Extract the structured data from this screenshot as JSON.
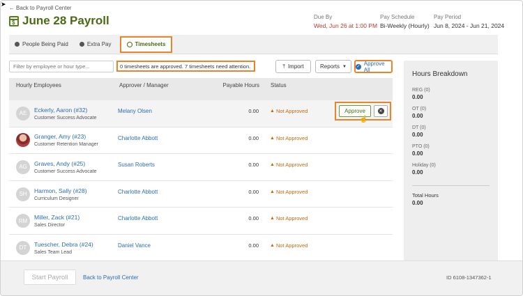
{
  "header": {
    "back_link": "Back to Payroll Center",
    "title": "June 28 Payroll",
    "calendar_glyph": "$",
    "due_by_label": "Due By",
    "due_by_value": "Wed, Jun 26 at 1:00 PM",
    "pay_schedule_label": "Pay Schedule",
    "pay_schedule_value": "Bi-Weekly (Hourly)",
    "pay_period_label": "Pay Period",
    "pay_period_value": "Jun 8, 2024 - Jun 21, 2024"
  },
  "tabs": [
    {
      "label": "People Being Paid",
      "icon": "person-icon"
    },
    {
      "label": "Extra Pay",
      "icon": "dollar-icon"
    },
    {
      "label": "Timesheets",
      "icon": "clock-icon",
      "active": true
    }
  ],
  "toolbar": {
    "filter_placeholder": "Filter by employee or hour type...",
    "status_note": "0 timesheets are approved. 7 timesheets need attention.",
    "import_label": "Import",
    "reports_label": "Reports",
    "approve_all_label": "Approve All"
  },
  "table": {
    "headers": {
      "employee": "Hourly Employees",
      "manager": "Approver / Manager",
      "hours": "Payable Hours",
      "status": "Status"
    },
    "rows": [
      {
        "initials": "AE",
        "name": "Eckerly, Aaron (#32)",
        "role": "Customer Success Advocate",
        "manager": "Melany Olsen",
        "hours": "0.00",
        "status": "Not Approved"
      },
      {
        "initials": "",
        "name": "Granger, Amy (#23)",
        "role": "Customer Retention Manager",
        "manager": "Charlotte Abbott",
        "hours": "0.00",
        "status": "Not Approved"
      },
      {
        "initials": "AG",
        "name": "Graves, Andy (#25)",
        "role": "Customer Success Advocate",
        "manager": "Susan Roberts",
        "hours": "0.00",
        "status": "Not Approved"
      },
      {
        "initials": "SH",
        "name": "Harmon, Sally (#28)",
        "role": "Curriculum Designer",
        "manager": "Charlotte Abbott",
        "hours": "0.00",
        "status": "Not Approved"
      },
      {
        "initials": "RM",
        "name": "Miller, Zack (#21)",
        "role": "Sales Director",
        "manager": "Charlotte Abbott",
        "hours": "0.00",
        "status": "Not Approved"
      },
      {
        "initials": "DT",
        "name": "Tuescher, Debra (#24)",
        "role": "Sales Team Lead",
        "manager": "Daniel Vance",
        "hours": "0.00",
        "status": "Not Approved"
      }
    ],
    "approve_label": "Approve"
  },
  "hours_breakdown": {
    "title": "Hours Breakdown",
    "items": [
      {
        "label": "REG (0)",
        "value": "0.00"
      },
      {
        "label": "OT (0)",
        "value": "0.00"
      },
      {
        "label": "DT (0)",
        "value": "0.00"
      },
      {
        "label": "PTO (0)",
        "value": "0.00"
      },
      {
        "label": "Holiday (0)",
        "value": "0.00"
      }
    ],
    "total_label": "Total Hours",
    "total_value": "0.00"
  },
  "footer": {
    "start_payroll_label": "Start Payroll",
    "back_link": "Back to Payroll Center",
    "id_text": "ID 6108-1347362-1"
  },
  "colors": {
    "accent_green": "#4a6a14",
    "link_blue": "#2a6db5",
    "highlight_orange": "#e8852a",
    "warning_orange": "#c46a12",
    "due_red": "#c0392b"
  }
}
